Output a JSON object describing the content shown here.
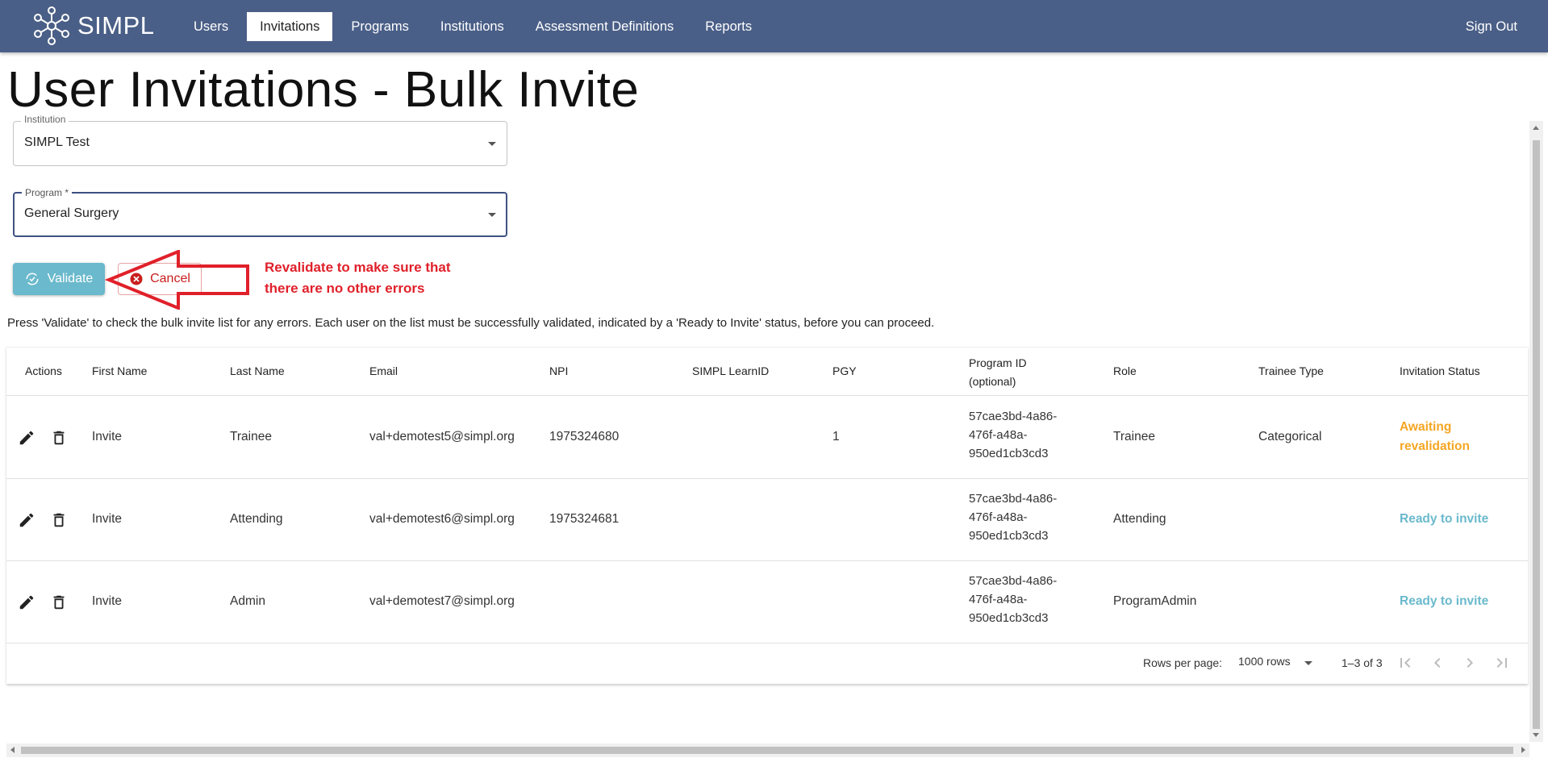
{
  "app": {
    "name": "SIMPL"
  },
  "nav": {
    "items": [
      {
        "label": "Users",
        "active": false
      },
      {
        "label": "Invitations",
        "active": true
      },
      {
        "label": "Programs",
        "active": false
      },
      {
        "label": "Institutions",
        "active": false
      },
      {
        "label": "Assessment Definitions",
        "active": false
      },
      {
        "label": "Reports",
        "active": false
      }
    ],
    "sign_out": "Sign Out"
  },
  "page": {
    "title": "User Invitations - Bulk Invite",
    "help_text": "Press 'Validate' to check the bulk invite list for any errors. Each user on the list must be successfully validated, indicated by a 'Ready to Invite' status, before you can proceed."
  },
  "form": {
    "institution": {
      "label": "Institution",
      "value": "SIMPL Test"
    },
    "program": {
      "label": "Program *",
      "value": "General Surgery"
    }
  },
  "buttons": {
    "validate": "Validate",
    "cancel": "Cancel"
  },
  "annotation": {
    "line1": "Revalidate to make sure that",
    "line2": "there are no other errors",
    "color": "#e0202a"
  },
  "table": {
    "headers": {
      "actions": "Actions",
      "first_name": "First Name",
      "last_name": "Last Name",
      "email": "Email",
      "npi": "NPI",
      "learn_id": "SIMPL LearnID",
      "pgy": "PGY",
      "program_id_1": "Program ID",
      "program_id_2": "(optional)",
      "role": "Role",
      "trainee_type": "Trainee Type",
      "status": "Invitation Status"
    },
    "rows": [
      {
        "first_name": "Invite",
        "last_name": "Trainee",
        "email": "val+demotest5@simpl.org",
        "npi": "1975324680",
        "learn_id": "",
        "pgy": "1",
        "program_id": [
          "57cae3bd-4a86-",
          "476f-a48a-",
          "950ed1cb3cd3"
        ],
        "role": "Trainee",
        "trainee_type": "Categorical",
        "status": [
          "Awaiting",
          "revalidation"
        ],
        "status_kind": "awaiting"
      },
      {
        "first_name": "Invite",
        "last_name": "Attending",
        "email": "val+demotest6@simpl.org",
        "npi": "1975324681",
        "learn_id": "",
        "pgy": "",
        "program_id": [
          "57cae3bd-4a86-",
          "476f-a48a-",
          "950ed1cb3cd3"
        ],
        "role": "Attending",
        "trainee_type": "",
        "status": [
          "Ready to invite"
        ],
        "status_kind": "ready"
      },
      {
        "first_name": "Invite",
        "last_name": "Admin",
        "email": "val+demotest7@simpl.org",
        "npi": "",
        "learn_id": "",
        "pgy": "",
        "program_id": [
          "57cae3bd-4a86-",
          "476f-a48a-",
          "950ed1cb3cd3"
        ],
        "role": "ProgramAdmin",
        "trainee_type": "",
        "status": [
          "Ready to invite"
        ],
        "status_kind": "ready"
      }
    ]
  },
  "pagination": {
    "rows_per_page_label": "Rows per page:",
    "rows_per_page_value": "1000 rows",
    "count": "1–3 of 3"
  },
  "colors": {
    "nav_bg": "#4a5f87",
    "validate_bg": "#6ab9cc",
    "awaiting": "#f5a623",
    "ready": "#6ab9cc",
    "cancel": "#c81e1e"
  },
  "icons": {
    "logo": "molecule-logo-icon",
    "validate": "sync-icon",
    "cancel": "cancel-circle-icon",
    "edit": "pencil-icon",
    "delete": "trash-icon",
    "first_page": "first-page-icon",
    "prev_page": "chevron-left-icon",
    "next_page": "chevron-right-icon",
    "last_page": "last-page-icon"
  }
}
